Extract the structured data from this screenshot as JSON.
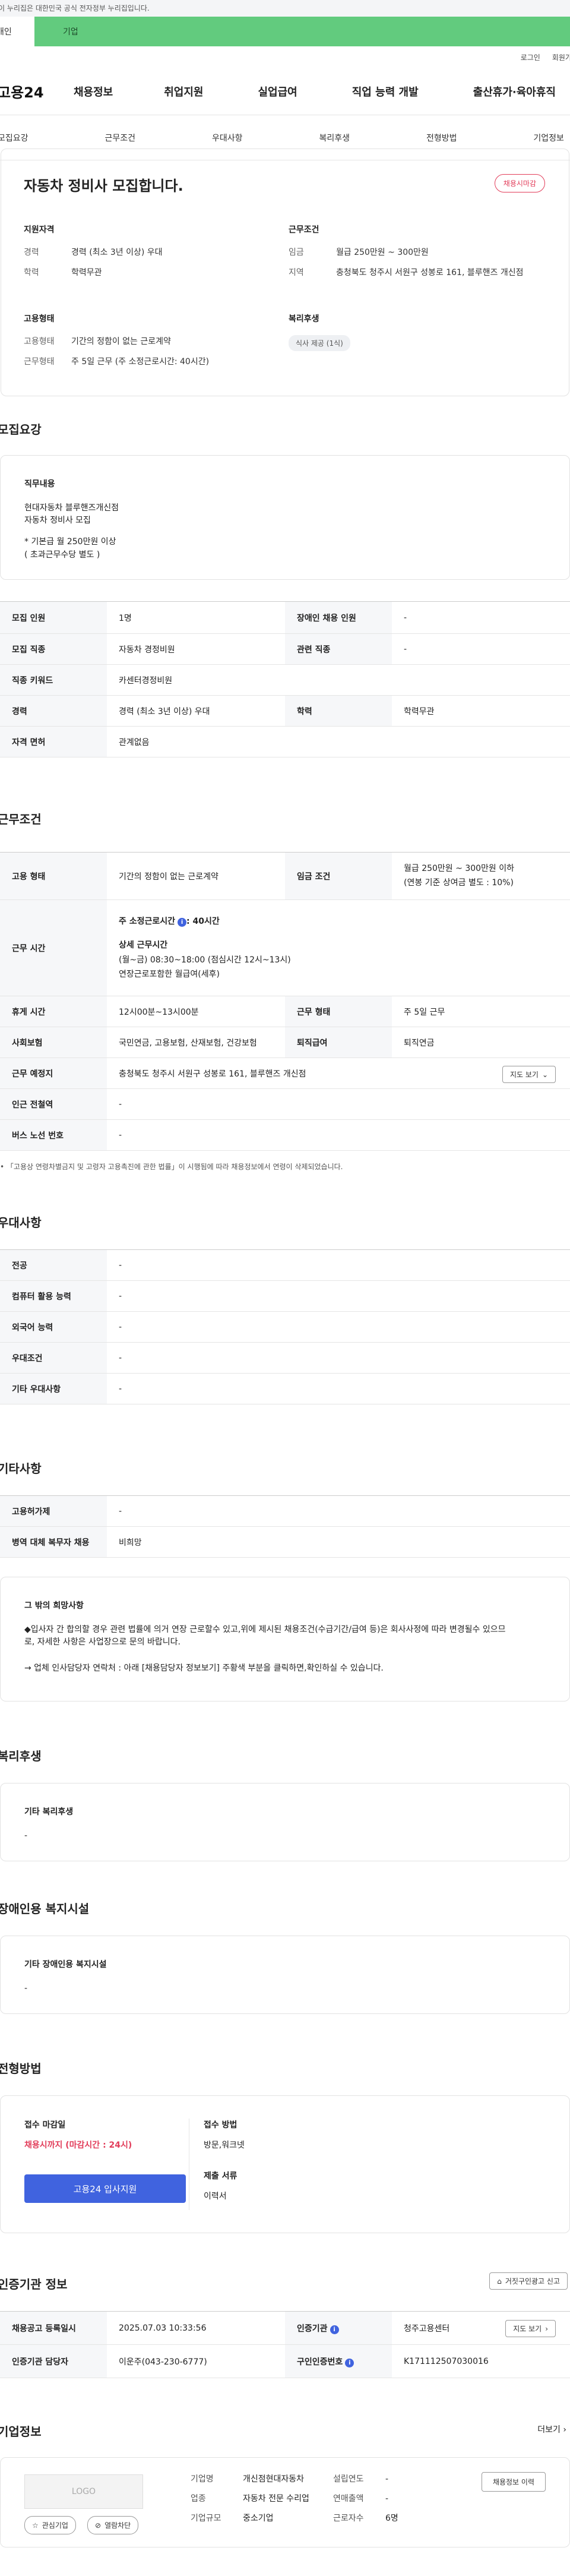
{
  "gov_banner": "이 누리집은 대한민국 공식 전자정부 누리집입니다.",
  "tabs": {
    "personal": "개인",
    "company": "기업"
  },
  "util": {
    "login": "로그인",
    "join": "회원가입"
  },
  "gnb": {
    "logo": "고용24",
    "items": [
      "채용정보",
      "취업지원",
      "실업급여",
      "직업 능력 개발",
      "출산휴가·육아휴직"
    ]
  },
  "subnav": [
    "모집요강",
    "근무조건",
    "우대사항",
    "복리후생",
    "전형방법",
    "기업정보"
  ],
  "summary": {
    "title": "자동차 정비사 모집합니다.",
    "status_badge": "채용시마감",
    "qualification": {
      "heading": "지원자격",
      "career_k": "경력",
      "career_v": "경력 (최소 3년 이상) 우대",
      "edu_k": "학력",
      "edu_v": "학력무관"
    },
    "conditions": {
      "heading": "근무조건",
      "wage_k": "임금",
      "wage_v": "월급 250만원 ~ 300만원",
      "region_k": "지역",
      "region_v": "충청북도 청주시 서원구 성봉로 161, 블루핸즈 개신점"
    },
    "employment": {
      "heading": "고용형태",
      "type_k": "고용형태",
      "type_v": "기간의 정함이 없는 근로계약",
      "work_k": "근무형태",
      "work_v": "주 5일 근무 (주 소정근로시간: 40시간)"
    },
    "welfare": {
      "heading": "복리후생",
      "chip": "식사 제공 (1식)"
    }
  },
  "recruit": {
    "section_title": "모집요강",
    "job_desc_heading": "직무내용",
    "job_desc_lines": [
      "현대자동차 블루핸즈개신점",
      "자동차 정비사 모집",
      "",
      "* 기본급 월 250만원 이상",
      "( 초과근무수당 별도 )"
    ],
    "rows": {
      "count_k": "모집 인원",
      "count_v": "1명",
      "disabled_k": "장애인 채용 인원",
      "disabled_v": "-",
      "job_k": "모집 직종",
      "job_v": "자동차 경정비원",
      "related_k": "관련 직종",
      "related_v": "-",
      "keyword_k": "직종 키워드",
      "keyword_v": "카센터경정비원",
      "career_k": "경력",
      "career_v": "경력 (최소 3년 이상) 우대",
      "edu_k": "학력",
      "edu_v": "학력무관",
      "license_k": "자격 면허",
      "license_v": "관계없음"
    }
  },
  "work": {
    "section_title": "근무조건",
    "type_k": "고용 형태",
    "type_v": "기간의 정함이 없는 근로계약",
    "wage_k": "임금 조건",
    "wage_v": "월급 250만원 ~ 300만원 이하",
    "wage_sub": "(연봉 기준 상여금 별도 : 10%)",
    "time_k": "근무 시간",
    "time_weekly": "주 소정근로시간",
    "time_weekly_v": ": 40시간",
    "time_detail_h": "상세 근무시간",
    "time_detail_1": "(월~금) 08:30~18:00 (점심시간 12시~13시)",
    "time_detail_2": "연장근로포함한 월급여(세후)",
    "break_k": "휴게 시간",
    "break_v": "12시00분~13시00분",
    "form_k": "근무 형태",
    "form_v": "주 5일 근무",
    "insurance_k": "사회보험",
    "insurance_v": "국민연금, 고용보험, 산재보험, 건강보험",
    "retire_k": "퇴직급여",
    "retire_v": "퇴직연금",
    "place_k": "근무 예정지",
    "place_v": "충청북도 청주시 서원구 성봉로 161, 블루핸즈 개신점",
    "map_btn": "지도 보기",
    "subway_k": "인근 전철역",
    "subway_v": "-",
    "bus_k": "버스 노선 번호",
    "bus_v": "-",
    "notice": "「고용상 연령차별금지 및 고령자 고용촉진에 관한 법률」이 시행됨에 따라 채용정보에서 연령이 삭제되었습니다."
  },
  "pref": {
    "section_title": "우대사항",
    "rows": [
      [
        "전공",
        "-"
      ],
      [
        "컴퓨터 활용 능력",
        "-"
      ],
      [
        "외국어 능력",
        "-"
      ],
      [
        "우대조건",
        "-"
      ],
      [
        "기타 우대사항",
        "-"
      ]
    ]
  },
  "etc": {
    "section_title": "기타사항",
    "rows": [
      [
        "고용허가제",
        "-"
      ],
      [
        "병역 대체 복무자 채용",
        "비희망"
      ]
    ],
    "box_heading": "그 밖의 희망사항",
    "box_line1": "◆입사자 간 합의할 경우 관련 법률에 의거 연장 근로할수 있고,위에 제시된 채용조건(수급기간/급여 등)은 회사사정에 따라 변경될수 있으므",
    "box_line2": "로, 자세한 사항은 사업장으로 문의 바랍니다.",
    "box_line3": "→ 업체 인사담당자 연락처 :  아래 [채용담당자 정보보기] 주황색 부분을 클릭하면,확인하실 수 있습니다."
  },
  "welfare": {
    "section_title": "복리후생",
    "heading": "기타 복리후생",
    "value": "-"
  },
  "disabled_fac": {
    "section_title": "장애인용 복지시설",
    "heading": "기타 장애인용 복지시설",
    "value": "-"
  },
  "selection": {
    "section_title": "전형방법",
    "deadline_h": "접수 마감일",
    "deadline_v": "채용시까지 (마감시간 : 24시)",
    "apply_btn": "고용24 입사지원",
    "method_h": "접수 방법",
    "method_v": "방문,워크넷",
    "docs_h": "제출 서류",
    "docs_v": "이력서"
  },
  "cert": {
    "section_title": "인증기관 정보",
    "report_btn": "거짓구인광고 신고",
    "date_k": "채용공고 등록일시",
    "date_v": "2025.07.03 10:33:56",
    "org_k": "인증기관",
    "org_v": "청주고용센터",
    "map_btn": "지도 보기",
    "manager_k": "인증기관 담당자",
    "manager_v": "이운주(043-230-6777)",
    "reqno_k": "구인인증번호",
    "reqno_v": "K171112507030016"
  },
  "company": {
    "section_title": "기업정보",
    "more": "더보기",
    "logo_placeholder": "LOGO",
    "fav_btn": "관심기업",
    "block_btn": "열람차단",
    "name_k": "기업명",
    "name_v": "개신점현대자동차",
    "industry_k": "업종",
    "industry_v": "자동차 전문 수리업",
    "size_k": "기업규모",
    "size_v": "중소기업",
    "founded_k": "설립연도",
    "founded_v": "-",
    "revenue_k": "연매출액",
    "revenue_v": "-",
    "staff_k": "근로자수",
    "staff_v": "6명",
    "jobs_btn": "채용정보 이력"
  },
  "colors": {
    "green": "#62cb7e",
    "blue": "#4063df",
    "red": "#e23d5a"
  }
}
